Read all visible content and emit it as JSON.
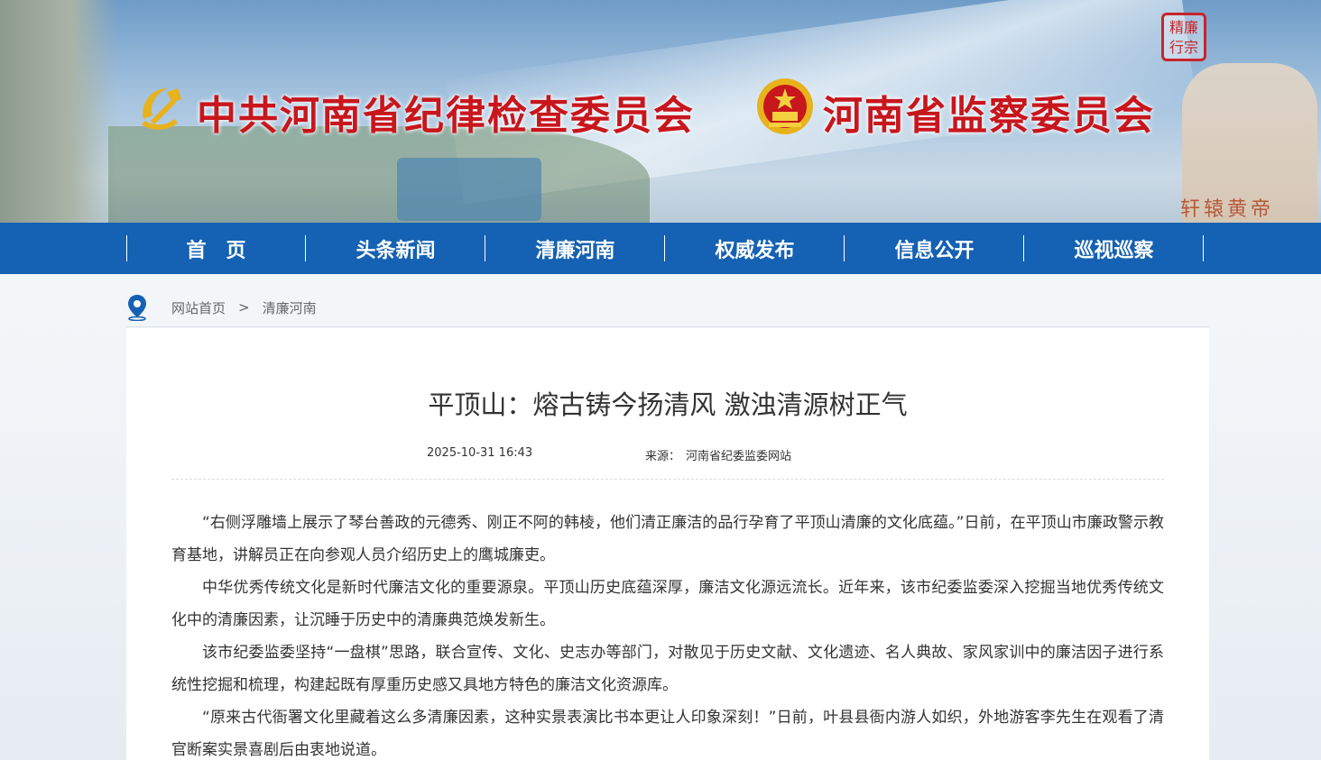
{
  "header": {
    "title_cpc": "中共河南省纪律检查委员会",
    "title_supervision": "河南省监察委员会",
    "seal_text": "精廉 行宗",
    "statue_label": "轩辕黄帝",
    "colors": {
      "title_red": "#c8161d",
      "nav_blue": "#1561b3"
    }
  },
  "nav": {
    "items": [
      {
        "label": "首　页"
      },
      {
        "label": "头条新闻"
      },
      {
        "label": "清廉河南"
      },
      {
        "label": "权威发布"
      },
      {
        "label": "信息公开"
      },
      {
        "label": "巡视巡察"
      }
    ]
  },
  "breadcrumb": {
    "icon": "location-pin-icon",
    "home": "网站首页",
    "separator": ">",
    "current": "清廉河南"
  },
  "article": {
    "title": "平顶山：熔古铸今扬清风 激浊清源树正气",
    "date": "2025-10-31 16:43",
    "source_label": "来源：",
    "source_value": "河南省纪委监委网站",
    "paragraphs": [
      "“右侧浮雕墙上展示了琴台善政的元德秀、刚正不阿的韩棱，他们清正廉洁的品行孕育了平顶山清廉的文化底蕴。”日前，在平顶山市廉政警示教育基地，讲解员正在向参观人员介绍历史上的鹰城廉吏。",
      "中华优秀传统文化是新时代廉洁文化的重要源泉。平顶山历史底蕴深厚，廉洁文化源远流长。近年来，该市纪委监委深入挖掘当地优秀传统文化中的清廉因素，让沉睡于历史中的清廉典范焕发新生。",
      "该市纪委监委坚持“一盘棋”思路，联合宣传、文化、史志办等部门，对散见于历史文献、文化遗迹、名人典故、家风家训中的廉洁因子进行系统性挖掘和梳理，构建起既有厚重历史感又具地方特色的廉洁文化资源库。",
      "“原来古代衙署文化里藏着这么多清廉因素，这种实景表演比书本更让人印象深刻！”日前，叶县县衙内游人如织，外地游客李先生在观看了清官断案实景喜剧后由衷地说道。"
    ]
  }
}
